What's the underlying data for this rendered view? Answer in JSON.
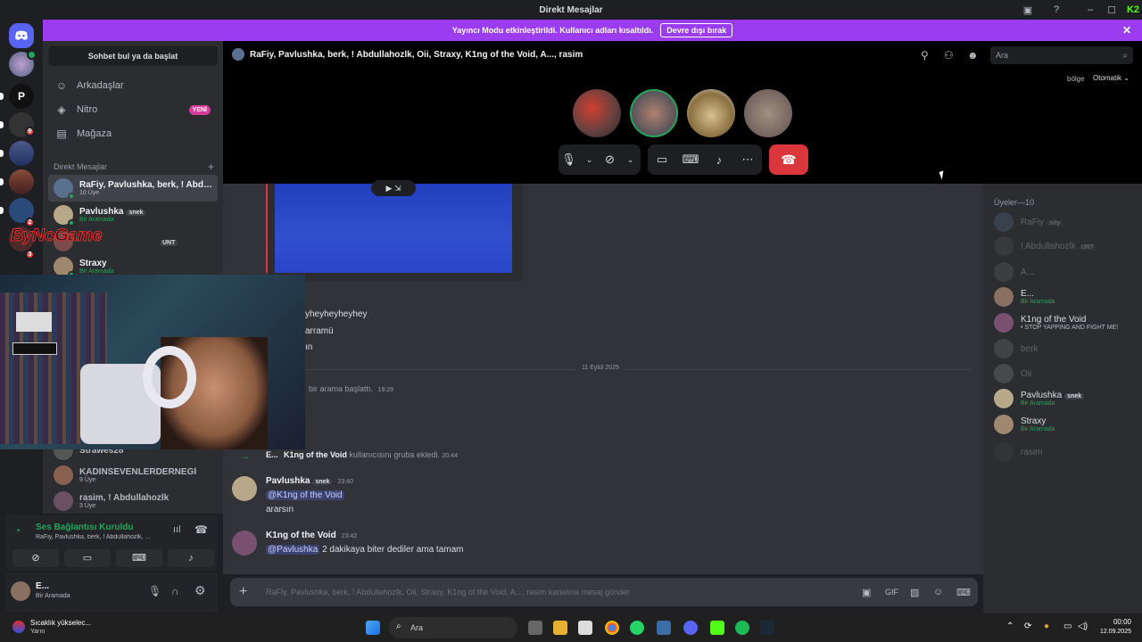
{
  "window": {
    "title": "Direkt Mesajlar",
    "min": "–",
    "max": "☐",
    "close": "✕"
  },
  "streamer_bar": {
    "text": "Yayıncı Modu etkinleştirildi. Kullanıcı adları kısaltıldı.",
    "button": "Devre dışı bırak",
    "close": "✕"
  },
  "dm_sidebar": {
    "search": "Sohbet bul ya da başlat",
    "nav": [
      {
        "label": "Arkadaşlar"
      },
      {
        "label": "Nitro",
        "badge": "YENİ"
      },
      {
        "label": "Mağaza"
      }
    ],
    "section": "Direkt Mesajlar",
    "items": [
      {
        "name": "RaFiy, Pavlushka, berk, ! Abdullahozlk, Oii, Straxy, K1ng of the Void, A..., rasim",
        "sub": "10 Üye"
      },
      {
        "name": "Pavlushka",
        "tag": "snek",
        "sub": "Bir Aramada"
      },
      {
        "name": "",
        "tag": "UNT",
        "sub": ""
      },
      {
        "name": "Straxy",
        "sub": "Bir Aramada"
      },
      {
        "name": "Strawes28",
        "sub": ""
      },
      {
        "name": "KADINSEVENLERDERNEĞİ",
        "sub": "9 Üye"
      },
      {
        "name": "rasim, ! Abdullahozlk",
        "sub": "3 Üye"
      }
    ],
    "watermark": "ByNoGame"
  },
  "voice": {
    "status": "Ses Bağlantısı Kuruldu",
    "channel": "RaFiy, Pavlushka, berk, ! Abdullahozlk, ..."
  },
  "user": {
    "name": "E...",
    "status": "Bir Aramada"
  },
  "call": {
    "title": "RaFiy, Pavlushka, berk, ! Abdullahozlk, Oii, Straxy, K1ng of the Void, A..., rasim",
    "search_placeholder": "Ara",
    "region_label": "bölge",
    "region_value": "Otomatik"
  },
  "chat": {
    "lines": [
      "yheyheyheyhey",
      "arramü",
      "ın"
    ],
    "date_divider": "11 Eylül 2025",
    "call_started": {
      "text": "bir arama başlattı.",
      "time": "19:29"
    },
    "added": {
      "actor": "E...",
      "target": "K1ng of the Void",
      "text": "kullanıcısını gruba ekledi.",
      "time": "20:44"
    },
    "messages": [
      {
        "author": "Pavlushka",
        "tag": "snek",
        "time": "23:40",
        "mention": "@K1ng of the Void",
        "body": "ararsın"
      },
      {
        "author": "K1ng of the Void",
        "time": "23:42",
        "mention": "@Pavlushka",
        "body": "2 dakikaya biter dediler ama tamam"
      }
    ],
    "composer_placeholder": "RaFiy, Pavlushka, berk, ! Abdullahozlk, Oii, Straxy, K1ng of the Void, A..., rasim kanalına mesaj gönder"
  },
  "members": {
    "header": "Üyeler—10",
    "list": [
      {
        "name": "RaFiy",
        "tag": "nity",
        "sub": "",
        "dim": true
      },
      {
        "name": "! Abdullahozlk",
        "tag": "UNT",
        "sub": "",
        "dim": true
      },
      {
        "name": "A...",
        "sub": "",
        "dim": true
      },
      {
        "name": "E...",
        "sub": "Bir Aramada",
        "dim": false
      },
      {
        "name": "K1ng of the Void",
        "sub": "• STOP YAPPING AND FIGHT ME!",
        "dim": false
      },
      {
        "name": "berk",
        "sub": "",
        "dim": true
      },
      {
        "name": "Oii",
        "sub": "",
        "dim": true
      },
      {
        "name": "Pavlushka",
        "tag": "snek",
        "sub": "Bir Aramada",
        "dim": false
      },
      {
        "name": "Straxy",
        "sub": "Bir Aramada",
        "dim": false
      },
      {
        "name": "rasim",
        "sub": "",
        "dim": true
      }
    ]
  },
  "taskbar": {
    "weather_title": "Sıcaklık yükselec...",
    "weather_sub": "Yarın",
    "search": "Ara",
    "time": "00:00",
    "date": "12.09.2025"
  },
  "colors": {
    "accent": "#9b3cf0",
    "green": "#23a55a",
    "red": "#da373c",
    "brand": "#5865f2"
  }
}
